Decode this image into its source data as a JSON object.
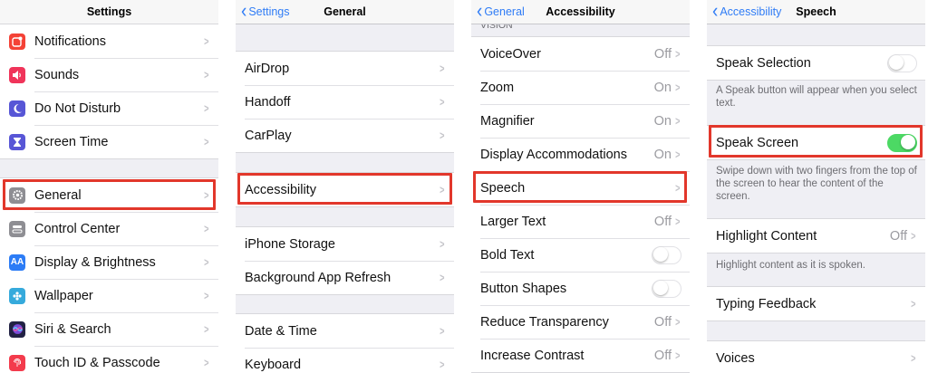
{
  "panels": {
    "settings": {
      "title": "Settings",
      "group1": [
        {
          "label": "Notifications",
          "icon": "notifications-icon",
          "color": "#f44236"
        },
        {
          "label": "Sounds",
          "icon": "sounds-icon",
          "color": "#f0345a"
        },
        {
          "label": "Do Not Disturb",
          "icon": "moon-icon",
          "color": "#5756d6"
        },
        {
          "label": "Screen Time",
          "icon": "hourglass-icon",
          "color": "#5856d6"
        }
      ],
      "group2": [
        {
          "label": "General",
          "icon": "gear-icon",
          "color": "#8e8e93"
        },
        {
          "label": "Control Center",
          "icon": "control-center-icon",
          "color": "#8e8e93"
        },
        {
          "label": "Display & Brightness",
          "icon": "display-icon",
          "color": "#2c7cf6",
          "glyph": "AA"
        },
        {
          "label": "Wallpaper",
          "icon": "wallpaper-icon",
          "color": "#36aadc"
        },
        {
          "label": "Siri & Search",
          "icon": "siri-icon",
          "color": "#222244"
        },
        {
          "label": "Touch ID & Passcode",
          "icon": "fingerprint-icon",
          "color": "#f33b4c"
        }
      ]
    },
    "general": {
      "back": "Settings",
      "title": "General",
      "group1": [
        "AirDrop",
        "Handoff",
        "CarPlay"
      ],
      "group2": [
        "Accessibility"
      ],
      "group3": [
        "iPhone Storage",
        "Background App Refresh"
      ],
      "group4": [
        "Date & Time",
        "Keyboard"
      ]
    },
    "accessibility": {
      "back": "General",
      "title": "Accessibility",
      "section_header": "VISION",
      "rows": [
        {
          "label": "VoiceOver",
          "value": "Off"
        },
        {
          "label": "Zoom",
          "value": "On"
        },
        {
          "label": "Magnifier",
          "value": "On"
        },
        {
          "label": "Display Accommodations",
          "value": "On"
        },
        {
          "label": "Speech",
          "value": ""
        },
        {
          "label": "Larger Text",
          "value": "Off"
        },
        {
          "label": "Bold Text",
          "toggle": false
        },
        {
          "label": "Button Shapes",
          "toggle": false
        },
        {
          "label": "Reduce Transparency",
          "value": "Off"
        },
        {
          "label": "Increase Contrast",
          "value": "Off"
        }
      ]
    },
    "speech": {
      "back": "Accessibility",
      "title": "Speech",
      "speak_selection": {
        "label": "Speak Selection",
        "toggle": false
      },
      "speak_selection_footer": "A Speak button will appear when you select text.",
      "speak_screen": {
        "label": "Speak Screen",
        "toggle": true
      },
      "speak_screen_footer": "Swipe down with two fingers from the top of the screen to hear the content of the screen.",
      "highlight_content": {
        "label": "Highlight Content",
        "value": "Off"
      },
      "highlight_footer": "Highlight content as it is spoken.",
      "typing_feedback": {
        "label": "Typing Feedback"
      },
      "voices": {
        "label": "Voices"
      }
    }
  },
  "colors": {
    "highlight": "#e2372b",
    "ios_blue": "#2f7cf6",
    "toggle_on": "#4cd964"
  }
}
